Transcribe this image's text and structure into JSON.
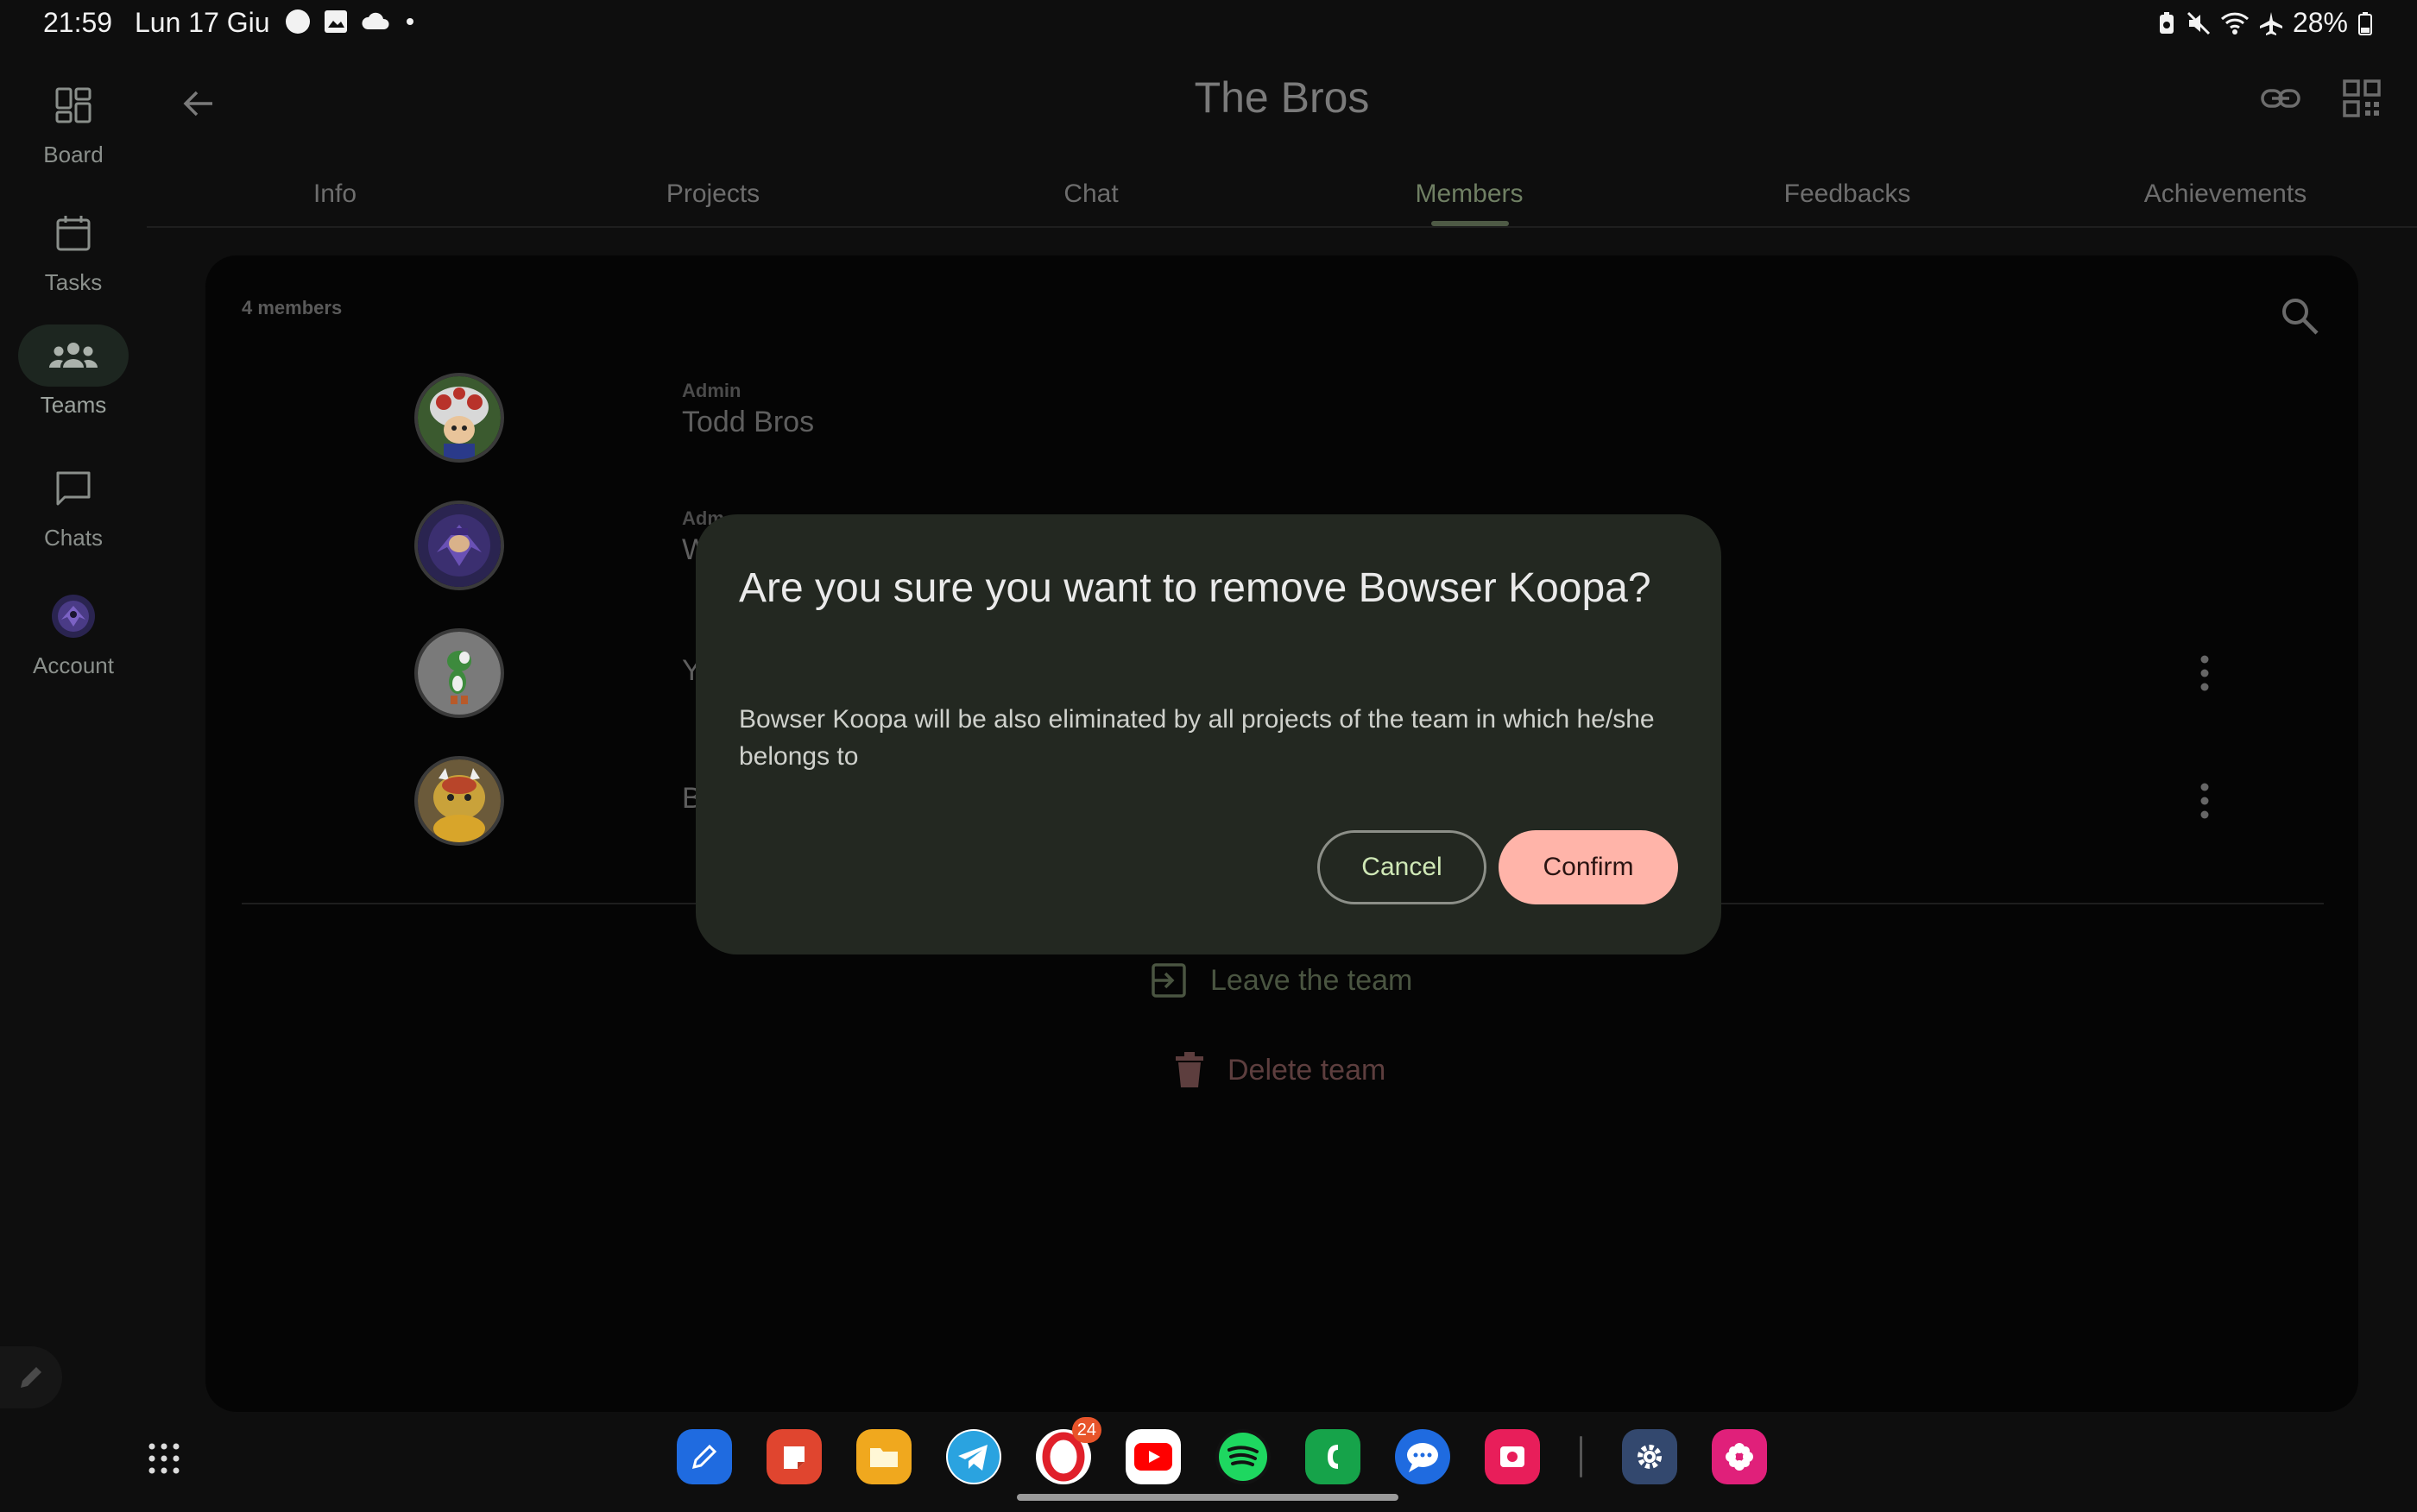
{
  "status_bar": {
    "time": "21:59",
    "date": "Lun 17 Giu",
    "battery": "28%",
    "left_icons": [
      "circle-icon",
      "gallery-icon",
      "cloud-icon",
      "dot-icon"
    ],
    "right_icons": [
      "battery-saver-icon",
      "mute-icon",
      "wifi-icon",
      "airplane-icon",
      "battery-icon"
    ]
  },
  "nav_rail": {
    "items": [
      {
        "label": "Board",
        "icon": "board-icon"
      },
      {
        "label": "Tasks",
        "icon": "calendar-icon"
      },
      {
        "label": "Teams",
        "icon": "groups-icon",
        "active": true
      },
      {
        "label": "Chats",
        "icon": "chat-bubble-icon"
      },
      {
        "label": "Account",
        "icon": "account-avatar-icon"
      }
    ]
  },
  "header": {
    "title": "The Bros"
  },
  "tabs": [
    "Info",
    "Projects",
    "Chat",
    "Members",
    "Feedbacks",
    "Achievements"
  ],
  "active_tab": "Members",
  "members": {
    "count_label": "4 members",
    "rows": [
      {
        "role": "Admin",
        "name": "Todd Bros",
        "avatar": "toad"
      },
      {
        "role": "Adm",
        "name": "W",
        "avatar": "waluigi"
      },
      {
        "role": "",
        "name": "Y",
        "avatar": "yoshi"
      },
      {
        "role": "",
        "name": "B",
        "avatar": "bowser"
      }
    ]
  },
  "actions": {
    "leave": "Leave the team",
    "delete": "Delete team"
  },
  "dialog": {
    "title": "Are you sure you want to remove Bowser Koopa?",
    "body": "Bowser Koopa will be also eliminated by all projects of the team in which he/she belongs to",
    "cancel": "Cancel",
    "confirm": "Confirm"
  },
  "dock": {
    "badge": "24",
    "apps": [
      "notes-app-icon",
      "notes-red-app-icon",
      "files-app-icon",
      "telegram-app-icon",
      "opera-app-icon",
      "youtube-app-icon",
      "spotify-app-icon",
      "phone-app-icon",
      "messages-app-icon",
      "screen-recorder-app-icon",
      "settings-app-icon",
      "flower-app-icon"
    ]
  },
  "colors": {
    "dialog_bg": "#232821",
    "confirm_bg": "#ffb4a9",
    "active_tab": "#6f7f63",
    "delete": "#5d3e3e"
  }
}
